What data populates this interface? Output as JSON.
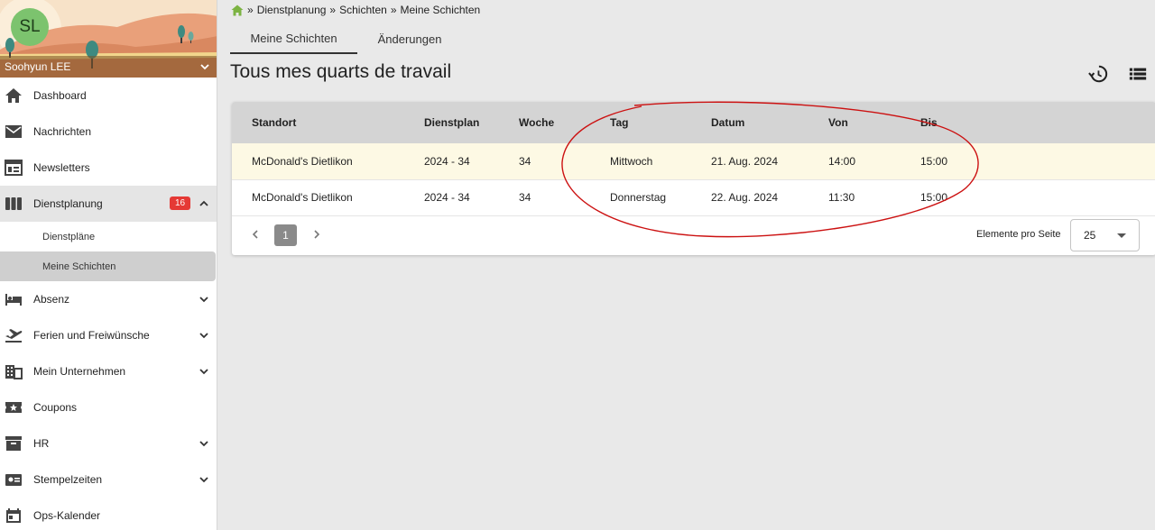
{
  "user": {
    "initials": "SL",
    "name": "Soohyun LEE"
  },
  "sidebar": {
    "items": [
      {
        "label": "Dashboard",
        "icon": "home-icon"
      },
      {
        "label": "Nachrichten",
        "icon": "mail-icon"
      },
      {
        "label": "Newsletters",
        "icon": "newspaper-icon"
      },
      {
        "label": "Dienstplanung",
        "icon": "schedule-columns-icon",
        "badge": "16",
        "expanded": true
      },
      {
        "label": "Absenz",
        "icon": "bed-icon"
      },
      {
        "label": "Ferien und Freiwünsche",
        "icon": "airplane-icon"
      },
      {
        "label": "Mein Unternehmen",
        "icon": "building-icon"
      },
      {
        "label": "Coupons",
        "icon": "coupon-icon"
      },
      {
        "label": "HR",
        "icon": "archive-icon"
      },
      {
        "label": "Stempelzeiten",
        "icon": "badge-card-icon"
      },
      {
        "label": "Ops-Kalender",
        "icon": "calendar-icon"
      }
    ],
    "subitems": [
      {
        "label": "Dienstpläne"
      },
      {
        "label": "Meine Schichten",
        "selected": true
      }
    ]
  },
  "breadcrumb": {
    "sep": "»",
    "items": [
      "Dienstplanung",
      "Schichten",
      "Meine Schichten"
    ]
  },
  "tabs": [
    {
      "label": "Meine Schichten",
      "active": true
    },
    {
      "label": "Änderungen",
      "active": false
    }
  ],
  "page": {
    "title": "Tous mes quarts de travail"
  },
  "table": {
    "headers": [
      "Standort",
      "Dienstplan",
      "Woche",
      "Tag",
      "Datum",
      "Von",
      "Bis"
    ],
    "rows": [
      [
        "McDonald's Dietlikon",
        "2024 - 34",
        "34",
        "Mittwoch",
        "21. Aug. 2024",
        "14:00",
        "15:00"
      ],
      [
        "McDonald's Dietlikon",
        "2024 - 34",
        "34",
        "Donnerstag",
        "22. Aug. 2024",
        "11:30",
        "15:00"
      ]
    ]
  },
  "pagination": {
    "current_page": "1",
    "per_page_label": "Elemente pro Seite",
    "per_page_value": "25"
  },
  "colors": {
    "badge": "#e53935",
    "row_highlight": "#fdf9e4",
    "header_bg": "#d4d4d4",
    "annotation": "#cc1111"
  }
}
